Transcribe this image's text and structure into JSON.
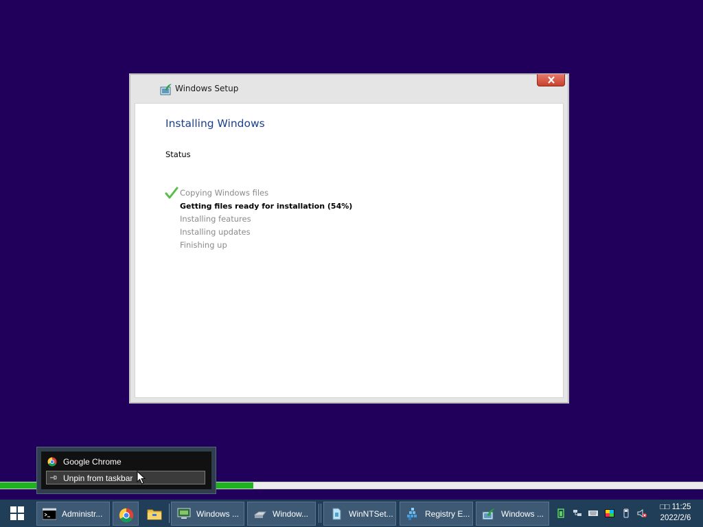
{
  "window": {
    "title": "Windows Setup",
    "heading": "Installing Windows",
    "status_label": "Status",
    "steps": [
      {
        "label": "Copying Windows files",
        "state": "done"
      },
      {
        "label": "Getting files ready for installation (54%)",
        "state": "active"
      },
      {
        "label": "Installing features",
        "state": "pending"
      },
      {
        "label": "Installing updates",
        "state": "pending"
      },
      {
        "label": "Finishing up",
        "state": "pending"
      }
    ]
  },
  "progress": {
    "value_percent": 36,
    "color": "#1fb31f"
  },
  "jump_list": {
    "app_name": "Google Chrome",
    "unpin_label": "Unpin from taskbar"
  },
  "taskbar": {
    "tasks": [
      {
        "label": "Administr...",
        "icon": "cmd-icon"
      },
      {
        "label": "Windows ...",
        "icon": "monitor-icon"
      },
      {
        "label": "Window...",
        "icon": "drive-icon"
      },
      {
        "label": "WinNTSet...",
        "icon": "setup-file-icon"
      },
      {
        "label": "Registry E...",
        "icon": "registry-icon"
      },
      {
        "label": "Windows ...",
        "icon": "windows-setup-icon"
      }
    ],
    "pinned": [
      {
        "name": "google-chrome",
        "icon": "chrome-icon"
      },
      {
        "name": "file-explorer",
        "icon": "folder-icon"
      }
    ],
    "clock": {
      "time": "□□ 11:25",
      "date": "2022/2/6"
    }
  },
  "colors": {
    "desktop": "#20005a",
    "taskbar": "#203e58",
    "heading": "#1b3f8b",
    "close_button": "#c8412d"
  }
}
